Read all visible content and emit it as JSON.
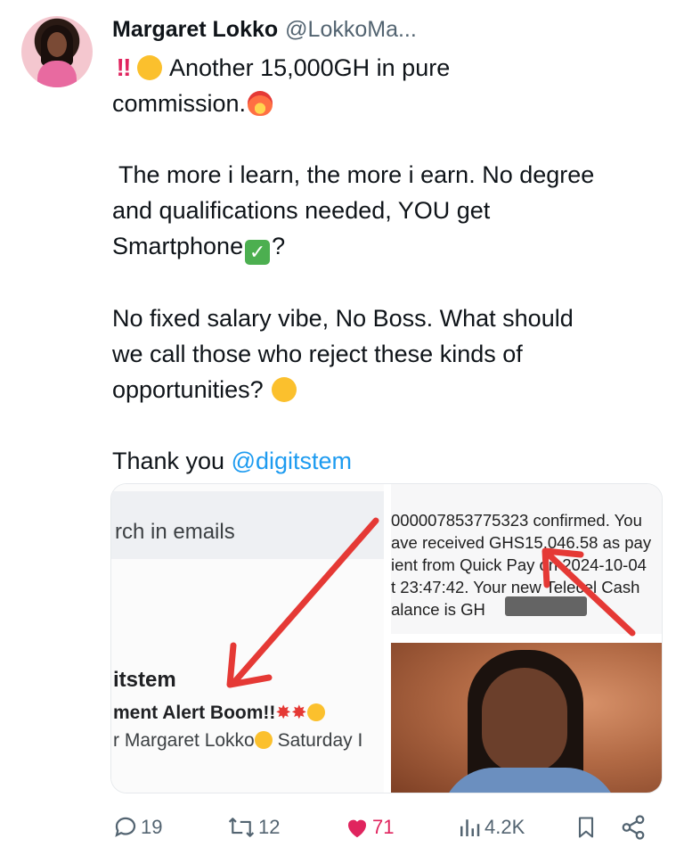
{
  "author": {
    "name": "Margaret Lokko",
    "handle": "@LokkoMa..."
  },
  "tweet": {
    "line1": "Another 15,000GH in pure",
    "line2": "commission.",
    "line3": " The more i learn, the more i earn. No degree",
    "line4": "and qualifications needed, YOU get",
    "line5a": "Smartphone",
    "line5b": "?",
    "line6": "No fixed salary vibe, No Boss. What should",
    "line7": "we call those who reject these kinds of",
    "line8": "opportunities?",
    "thanks": "Thank you ",
    "mention": "@digitstem",
    "emojis": {
      "alert": "double-exclamation-icon",
      "scream": "screaming-face-icon",
      "fire": "fire-icon",
      "check": "check-mark-icon",
      "think": "thinking-face-icon"
    }
  },
  "media": {
    "email": {
      "search_text": "rch in emails",
      "sender": "itstem",
      "subject": "ment Alert Boom!!",
      "preview": "r Margaret Lokko",
      "preview_tail": " Saturday I"
    },
    "sms": {
      "line1": "000007853775323 confirmed. You",
      "line2": "ave received GHS15,046.58 as pay",
      "line3": "ient from Quick Pay on 2024-10-04",
      "line4": "t 23:47:42. Your new Telecel Cash",
      "line5": "alance is GH"
    },
    "arrow_color": "#e53935"
  },
  "actions": {
    "replies": "19",
    "retweets": "12",
    "likes": "71",
    "views": "4.2K"
  },
  "colors": {
    "link": "#1d9bf0",
    "like": "#e0245e",
    "secondary": "#536471"
  }
}
